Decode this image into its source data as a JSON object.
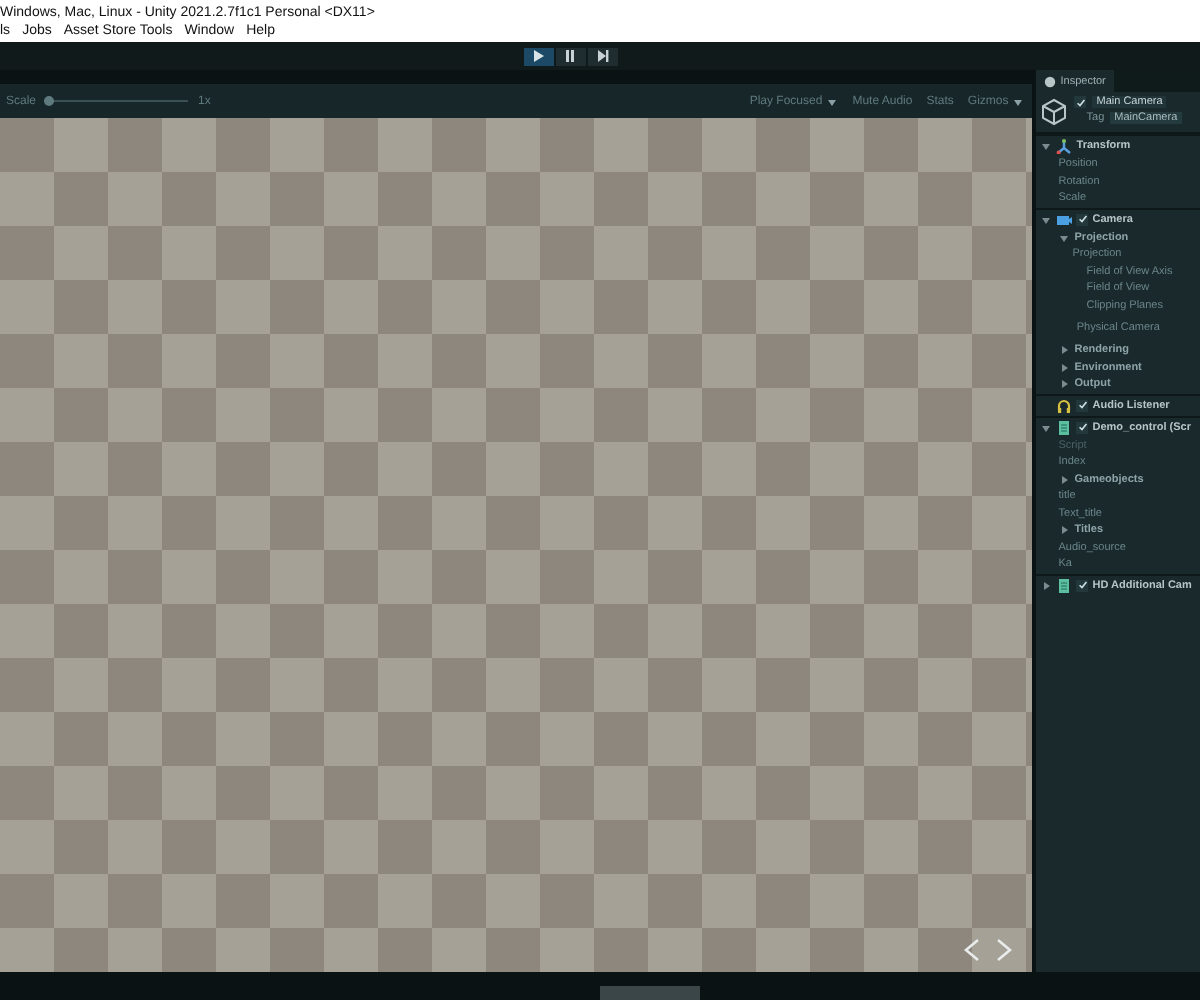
{
  "window": {
    "title": "Windows, Mac, Linux - Unity 2021.2.7f1c1 Personal <DX11>"
  },
  "menu": [
    "ls",
    "Jobs",
    "Asset Store Tools",
    "Window",
    "Help"
  ],
  "play_controls": [
    {
      "kind": "play",
      "on": true
    },
    {
      "kind": "pause",
      "on": false
    },
    {
      "kind": "step",
      "on": false
    }
  ],
  "game_toolbar": {
    "scale_label": "Scale",
    "scale": {
      "level": 0.0
    },
    "scale_value": "1x",
    "play_mode": "Play Focused",
    "mute": "Mute Audio",
    "stats": "Stats",
    "gizmos": "Gizmos"
  },
  "inspector": {
    "tab": "Inspector",
    "object": {
      "name": "Main Camera",
      "active": true,
      "tag_label": "Tag",
      "tag": "MainCamera"
    },
    "components": [
      {
        "title": "Transform",
        "kind": "transform",
        "expanded": true,
        "children": [
          {
            "label": "Position",
            "kind": "field"
          },
          {
            "label": "Rotation",
            "kind": "field"
          },
          {
            "label": "Scale",
            "kind": "field"
          }
        ]
      },
      {
        "title": "Camera",
        "kind": "camera",
        "enabled": true,
        "expanded": true,
        "children": [
          {
            "label": "Projection",
            "kind": "foldout",
            "expanded": true,
            "children": [
              {
                "label": "Projection",
                "kind": "field",
                "children": [
                  {
                    "label": "Field of View Axis",
                    "kind": "field"
                  },
                  {
                    "label": "Field of View",
                    "kind": "field"
                  },
                  {
                    "label": "Clipping Planes",
                    "kind": "field"
                  }
                ]
              }
            ]
          },
          {
            "label": "Physical Camera",
            "kind": "button"
          },
          {
            "label": "Rendering",
            "kind": "foldout",
            "expanded": false
          },
          {
            "label": "Environment",
            "kind": "foldout",
            "expanded": false
          },
          {
            "label": "Output",
            "kind": "foldout",
            "expanded": false
          }
        ]
      },
      {
        "title": "Audio Listener",
        "kind": "audio",
        "enabled": true
      },
      {
        "title": "Demo_control (Scr",
        "kind": "script",
        "enabled": true,
        "expanded": true,
        "children": [
          {
            "label": "Script",
            "kind": "field",
            "disabled": true
          },
          {
            "label": "Index",
            "kind": "field",
            "disabled": false
          },
          {
            "label": "Gameobjects",
            "kind": "foldout",
            "expanded": false,
            "disabled": false
          },
          {
            "label": "title",
            "kind": "field",
            "disabled": false
          },
          {
            "label": "Text_title",
            "kind": "field",
            "disabled": false
          },
          {
            "label": "Titles",
            "kind": "foldout",
            "expanded": false,
            "disabled": false
          },
          {
            "label": "Audio_source",
            "kind": "field",
            "disabled": false
          },
          {
            "label": "Ka",
            "kind": "field",
            "disabled": false
          }
        ]
      },
      {
        "title": "HD Additional Cam",
        "kind": "script",
        "enabled": true,
        "expanded": false
      }
    ]
  }
}
